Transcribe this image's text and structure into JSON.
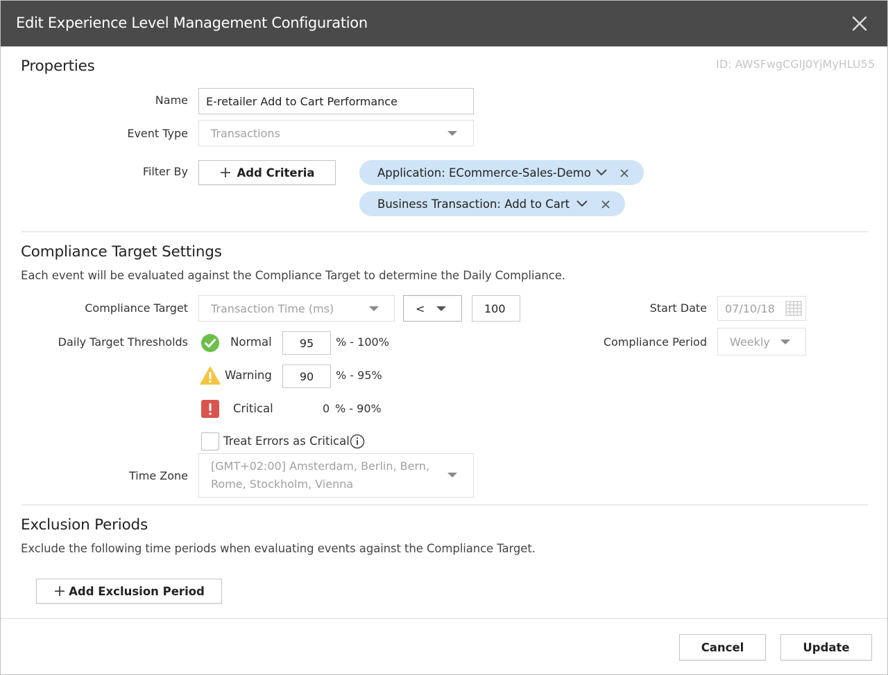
{
  "dialog": {
    "title": "Edit Experience Level Management Configuration"
  },
  "properties": {
    "title": "Properties",
    "id_text": "ID: AWSFwgCGIJ0YjMyHLU55",
    "name_label": "Name",
    "name_value": "E-retailer Add to Cart Performance",
    "event_type_label": "Event Type",
    "event_type_value": "Transactions",
    "filter_by_label": "Filter By",
    "add_criteria_label": "Add Criteria",
    "filters": [
      {
        "label": "Application: ECommerce-Sales-Demo"
      },
      {
        "label": "Business Transaction: Add to Cart"
      }
    ]
  },
  "compliance": {
    "title": "Compliance Target Settings",
    "description": "Each event will be evaluated against the Compliance Target to determine the Daily Compliance.",
    "target_label": "Compliance Target",
    "target_metric": "Transaction Time (ms)",
    "operator": "<",
    "target_value": "100",
    "start_date_label": "Start Date",
    "start_date_value": "07/10/18",
    "thresholds_label": "Daily Target Thresholds",
    "normal_label": "Normal",
    "normal_value": "95",
    "normal_range": "% - 100%",
    "warning_label": "Warning",
    "warning_value": "90",
    "warning_range": "% - 95%",
    "critical_label": "Critical",
    "critical_value": "0",
    "critical_range": "% - 90%",
    "period_label": "Compliance Period",
    "period_value": "Weekly",
    "treat_errors_label": "Treat Errors as Critical",
    "treat_errors_checked": false,
    "timezone_label": "Time Zone",
    "timezone_line1": "[GMT+02:00] Amsterdam, Berlin, Bern,",
    "timezone_line2": "Rome, Stockholm, Vienna",
    "colors": {
      "normal": "#6cc04a",
      "warning": "#f5c542",
      "critical": "#d9534f"
    }
  },
  "exclusion": {
    "title": "Exclusion Periods",
    "description": "Exclude the following time periods when evaluating events against the Compliance Target.",
    "add_label": "Add Exclusion Period"
  },
  "footer": {
    "cancel_label": "Cancel",
    "update_label": "Update"
  },
  "icons": {
    "close": "close-icon",
    "plus": "plus-icon",
    "chevron": "chevron-down-icon",
    "remove": "remove-icon",
    "calendar": "calendar-icon",
    "check": "check-circle-icon",
    "warning": "warning-triangle-icon",
    "critical": "critical-icon",
    "info": "info-icon"
  }
}
